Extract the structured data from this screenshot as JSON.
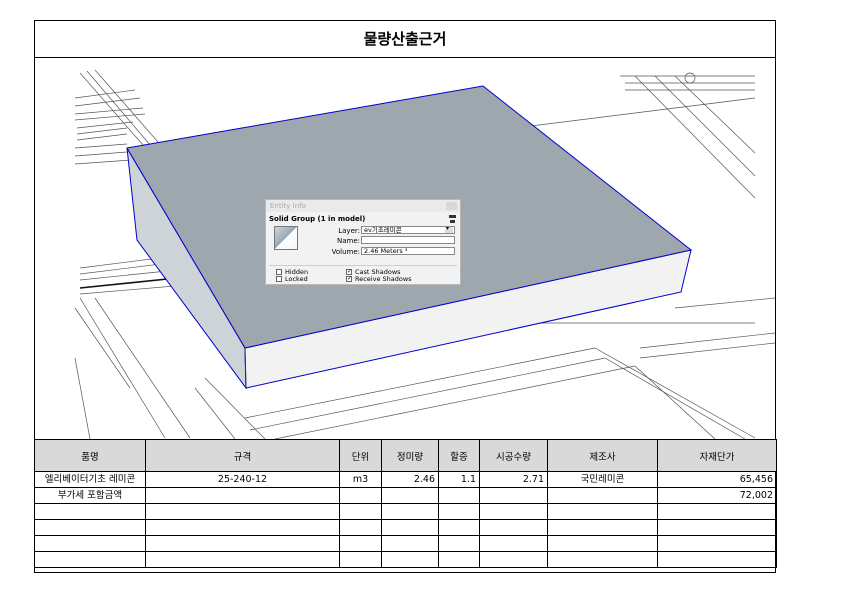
{
  "title": "물량산출근거",
  "entity_info": {
    "window_title": "Entity Info",
    "group_title": "Solid Group (1 in model)",
    "layer_label": "Layer:",
    "layer_value": "ev기초레미콘",
    "name_label": "Name:",
    "name_value": "",
    "volume_label": "Volume:",
    "volume_value": "2.46 Meters ³",
    "hidden_label": "Hidden",
    "locked_label": "Locked",
    "cast_shadows_label": "Cast Shadows",
    "receive_shadows_label": "Receive Shadows",
    "hidden_checked": false,
    "locked_checked": false,
    "cast_shadows_checked": true,
    "receive_shadows_checked": true
  },
  "table": {
    "headers": [
      "품명",
      "규격",
      "단위",
      "정미량",
      "할증",
      "시공수량",
      "제조사",
      "자재단가"
    ],
    "rows": [
      [
        "엘리베이터기초 레미콘",
        "25-240-12",
        "m3",
        "2.46",
        "1.1",
        "2.71",
        "국민레미콘",
        "65,456"
      ],
      [
        "부가세 포함금액",
        "",
        "",
        "",
        "",
        "",
        "",
        "72,002"
      ],
      [
        "",
        "",
        "",
        "",
        "",
        "",
        "",
        ""
      ],
      [
        "",
        "",
        "",
        "",
        "",
        "",
        "",
        ""
      ],
      [
        "",
        "",
        "",
        "",
        "",
        "",
        "",
        ""
      ],
      [
        "",
        "",
        "",
        "",
        "",
        "",
        "",
        ""
      ]
    ]
  },
  "colors": {
    "slab_top": "#9ea7ad",
    "slab_edge": "#0000cc",
    "slab_side": "#f2f2f2",
    "header_bg": "#d9d9d9"
  }
}
